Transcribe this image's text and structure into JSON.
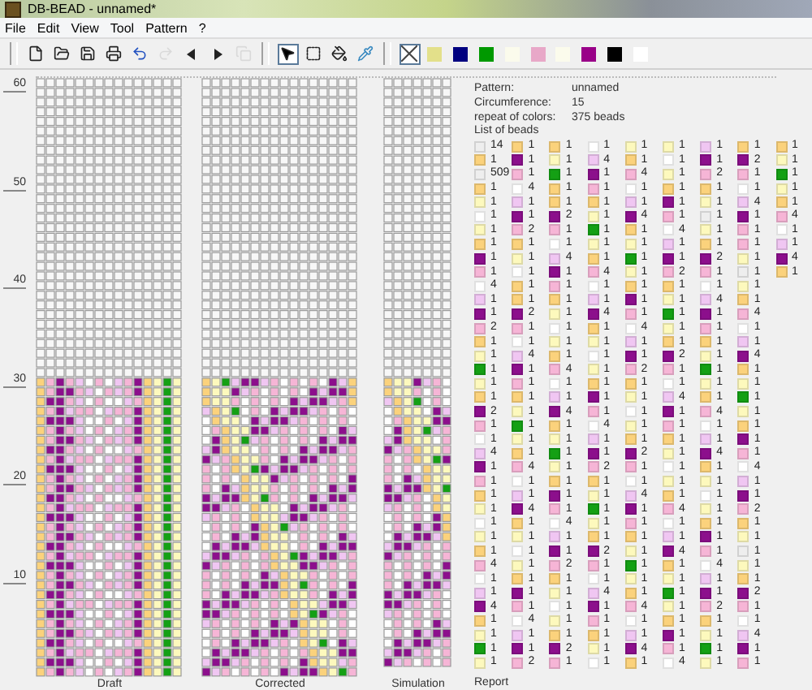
{
  "window": {
    "title": "DB-BEAD - unnamed*"
  },
  "menu": [
    "File",
    "Edit",
    "View",
    "Tool",
    "Pattern",
    "?"
  ],
  "tool_groups": [
    [
      {
        "kind": "new",
        "disabled": false,
        "selected": false
      },
      {
        "kind": "open",
        "disabled": false,
        "selected": false
      },
      {
        "kind": "save",
        "disabled": false,
        "selected": false
      },
      {
        "kind": "print",
        "disabled": false,
        "selected": false
      },
      {
        "kind": "undo",
        "disabled": false,
        "selected": false
      },
      {
        "kind": "redo",
        "disabled": true,
        "selected": false
      },
      {
        "kind": "left",
        "disabled": false,
        "selected": false
      },
      {
        "kind": "right",
        "disabled": false,
        "selected": false
      },
      {
        "kind": "copy",
        "disabled": true,
        "selected": false
      }
    ],
    [
      {
        "kind": "pointer",
        "disabled": false,
        "selected": true
      },
      {
        "kind": "rect",
        "disabled": false,
        "selected": false
      },
      {
        "kind": "fill",
        "disabled": false,
        "selected": false
      },
      {
        "kind": "pipette",
        "disabled": false,
        "selected": false
      }
    ],
    [
      {
        "kind": "none",
        "disabled": false,
        "selected": true
      }
    ]
  ],
  "palette": [
    {
      "color": "#e3e08a"
    },
    {
      "color": "#000080"
    },
    {
      "color": "#009900"
    },
    {
      "color": "#fbfbec"
    },
    {
      "color": "#e8a8c8"
    },
    {
      "color": "#fbfbec"
    },
    {
      "color": "#990088"
    },
    {
      "color": "#000000"
    },
    {
      "color": "#ffffff"
    }
  ],
  "ruler": [
    "60",
    "50",
    "40",
    "30",
    "20",
    "10"
  ],
  "views": [
    {
      "label": "Draft"
    },
    {
      "label": "Corrected"
    },
    {
      "label": "Simulation"
    }
  ],
  "info": [
    {
      "label": "Pattern:",
      "value": "unnamed"
    },
    {
      "label": "Circumference:",
      "value": "15"
    },
    {
      "label": "repeat of colors:",
      "value": "375 beads"
    }
  ],
  "list_title": "List of beads",
  "bead_rows": [
    [
      {
        "color": "#eeeeee",
        "count": "14"
      },
      {
        "color": "#fbd27c",
        "count": "1"
      },
      {
        "color": "#fbd27c",
        "count": "1"
      },
      {
        "color": "#ffffff",
        "count": "1"
      },
      {
        "color": "#fdf9bd",
        "count": "1"
      },
      {
        "color": "#fdf9bd",
        "count": "1"
      },
      {
        "color": "#f0c6f2",
        "count": "1"
      },
      {
        "color": "#fbd27c",
        "count": "1"
      },
      {
        "color": "#fbd27c",
        "count": "1"
      }
    ],
    [
      {
        "color": "#fbd27c",
        "count": "1"
      },
      {
        "color": "#8c0f8c",
        "count": "1"
      },
      {
        "color": "#fdf9bd",
        "count": "1"
      },
      {
        "color": "#f0c6f2",
        "count": "4"
      },
      {
        "color": "#fbd27c",
        "count": "1"
      },
      {
        "color": "#ffffff",
        "count": "1"
      },
      {
        "color": "#8c0f8c",
        "count": "1"
      },
      {
        "color": "#8c0f8c",
        "count": "2"
      },
      {
        "color": "#fdf9bd",
        "count": "1"
      }
    ],
    [
      {
        "color": "#eeeeee",
        "count": "509"
      },
      {
        "color": "#f6b5d6",
        "count": "1"
      },
      {
        "color": "#14a014",
        "count": "1"
      },
      {
        "color": "#8c0f8c",
        "count": "1"
      },
      {
        "color": "#f6b5d6",
        "count": "4"
      },
      {
        "color": "#fdf9bd",
        "count": "1"
      },
      {
        "color": "#f6b5d6",
        "count": "2"
      },
      {
        "color": "#f6b5d6",
        "count": "1"
      },
      {
        "color": "#14a014",
        "count": "1"
      }
    ],
    [
      {
        "color": "#fbd27c",
        "count": "1"
      },
      {
        "color": "#ffffff",
        "count": "4"
      },
      {
        "color": "#fbd27c",
        "count": "1"
      },
      {
        "color": "#f6b5d6",
        "count": "1"
      },
      {
        "color": "#ffffff",
        "count": "1"
      },
      {
        "color": "#fbd27c",
        "count": "1"
      },
      {
        "color": "#fbd27c",
        "count": "1"
      },
      {
        "color": "#ffffff",
        "count": "1"
      },
      {
        "color": "#fdf9bd",
        "count": "1"
      }
    ],
    [
      {
        "color": "#fdf9bd",
        "count": "1"
      },
      {
        "color": "#f0c6f2",
        "count": "1"
      },
      {
        "color": "#fbd27c",
        "count": "1"
      },
      {
        "color": "#fbd27c",
        "count": "1"
      },
      {
        "color": "#f0c6f2",
        "count": "1"
      },
      {
        "color": "#8c0f8c",
        "count": "1"
      },
      {
        "color": "#fdf9bd",
        "count": "1"
      },
      {
        "color": "#f0c6f2",
        "count": "4"
      },
      {
        "color": "#fbd27c",
        "count": "1"
      }
    ],
    [
      {
        "color": "#ffffff",
        "count": "1"
      },
      {
        "color": "#8c0f8c",
        "count": "1"
      },
      {
        "color": "#8c0f8c",
        "count": "2"
      },
      {
        "color": "#fdf9bd",
        "count": "1"
      },
      {
        "color": "#8c0f8c",
        "count": "4"
      },
      {
        "color": "#f6b5d6",
        "count": "1"
      },
      {
        "color": "#eeeeee",
        "count": "1"
      },
      {
        "color": "#8c0f8c",
        "count": "1"
      },
      {
        "color": "#f6b5d6",
        "count": "4"
      }
    ],
    [
      {
        "color": "#fdf9bd",
        "count": "1"
      },
      {
        "color": "#f6b5d6",
        "count": "2"
      },
      {
        "color": "#f6b5d6",
        "count": "1"
      },
      {
        "color": "#14a014",
        "count": "1"
      },
      {
        "color": "#fbd27c",
        "count": "1"
      },
      {
        "color": "#ffffff",
        "count": "4"
      },
      {
        "color": "#fdf9bd",
        "count": "1"
      },
      {
        "color": "#f6b5d6",
        "count": "1"
      },
      {
        "color": "#ffffff",
        "count": "1"
      }
    ],
    [
      {
        "color": "#fbd27c",
        "count": "1"
      },
      {
        "color": "#fbd27c",
        "count": "1"
      },
      {
        "color": "#ffffff",
        "count": "1"
      },
      {
        "color": "#fdf9bd",
        "count": "1"
      },
      {
        "color": "#fdf9bd",
        "count": "1"
      },
      {
        "color": "#f0c6f2",
        "count": "1"
      },
      {
        "color": "#fbd27c",
        "count": "1"
      },
      {
        "color": "#f6b5d6",
        "count": "1"
      },
      {
        "color": "#f0c6f2",
        "count": "1"
      }
    ],
    [
      {
        "color": "#8c0f8c",
        "count": "1"
      },
      {
        "color": "#fdf9bd",
        "count": "1"
      },
      {
        "color": "#f0c6f2",
        "count": "4"
      },
      {
        "color": "#fbd27c",
        "count": "1"
      },
      {
        "color": "#14a014",
        "count": "1"
      },
      {
        "color": "#8c0f8c",
        "count": "1"
      },
      {
        "color": "#8c0f8c",
        "count": "2"
      },
      {
        "color": "#fdf9bd",
        "count": "1"
      },
      {
        "color": "#8c0f8c",
        "count": "4"
      }
    ],
    [
      {
        "color": "#f6b5d6",
        "count": "1"
      },
      {
        "color": "#ffffff",
        "count": "1"
      },
      {
        "color": "#8c0f8c",
        "count": "1"
      },
      {
        "color": "#f6b5d6",
        "count": "4"
      },
      {
        "color": "#fdf9bd",
        "count": "1"
      },
      {
        "color": "#f6b5d6",
        "count": "2"
      },
      {
        "color": "#f6b5d6",
        "count": "1"
      },
      {
        "color": "#eeeeee",
        "count": "1"
      },
      {
        "color": "#fbd27c",
        "count": "1"
      }
    ],
    [
      {
        "color": "#ffffff",
        "count": "4"
      },
      {
        "color": "#fbd27c",
        "count": "1"
      },
      {
        "color": "#f6b5d6",
        "count": "1"
      },
      {
        "color": "#ffffff",
        "count": "1"
      },
      {
        "color": "#fbd27c",
        "count": "1"
      },
      {
        "color": "#fbd27c",
        "count": "1"
      },
      {
        "color": "#ffffff",
        "count": "1"
      },
      {
        "color": "#fdf9bd",
        "count": "1"
      }
    ],
    [
      {
        "color": "#f0c6f2",
        "count": "1"
      },
      {
        "color": "#fbd27c",
        "count": "1"
      },
      {
        "color": "#fbd27c",
        "count": "1"
      },
      {
        "color": "#f0c6f2",
        "count": "1"
      },
      {
        "color": "#8c0f8c",
        "count": "1"
      },
      {
        "color": "#fdf9bd",
        "count": "1"
      },
      {
        "color": "#f0c6f2",
        "count": "4"
      },
      {
        "color": "#fbd27c",
        "count": "1"
      }
    ],
    [
      {
        "color": "#8c0f8c",
        "count": "1"
      },
      {
        "color": "#8c0f8c",
        "count": "2"
      },
      {
        "color": "#fdf9bd",
        "count": "1"
      },
      {
        "color": "#8c0f8c",
        "count": "4"
      },
      {
        "color": "#f6b5d6",
        "count": "1"
      },
      {
        "color": "#14a014",
        "count": "1"
      },
      {
        "color": "#8c0f8c",
        "count": "1"
      },
      {
        "color": "#f6b5d6",
        "count": "4"
      }
    ],
    [
      {
        "color": "#f6b5d6",
        "count": "2"
      },
      {
        "color": "#f6b5d6",
        "count": "1"
      },
      {
        "color": "#ffffff",
        "count": "1"
      },
      {
        "color": "#fbd27c",
        "count": "1"
      },
      {
        "color": "#ffffff",
        "count": "4"
      },
      {
        "color": "#fdf9bd",
        "count": "1"
      },
      {
        "color": "#f6b5d6",
        "count": "1"
      },
      {
        "color": "#ffffff",
        "count": "1"
      }
    ],
    [
      {
        "color": "#fbd27c",
        "count": "1"
      },
      {
        "color": "#ffffff",
        "count": "1"
      },
      {
        "color": "#fdf9bd",
        "count": "1"
      },
      {
        "color": "#fdf9bd",
        "count": "1"
      },
      {
        "color": "#f0c6f2",
        "count": "1"
      },
      {
        "color": "#fbd27c",
        "count": "1"
      },
      {
        "color": "#fbd27c",
        "count": "1"
      },
      {
        "color": "#f0c6f2",
        "count": "1"
      }
    ],
    [
      {
        "color": "#fdf9bd",
        "count": "1"
      },
      {
        "color": "#f0c6f2",
        "count": "4"
      },
      {
        "color": "#fbd27c",
        "count": "1"
      },
      {
        "color": "#ffffff",
        "count": "1"
      },
      {
        "color": "#8c0f8c",
        "count": "1"
      },
      {
        "color": "#8c0f8c",
        "count": "2"
      },
      {
        "color": "#fdf9bd",
        "count": "1"
      },
      {
        "color": "#8c0f8c",
        "count": "4"
      }
    ],
    [
      {
        "color": "#14a014",
        "count": "1"
      },
      {
        "color": "#8c0f8c",
        "count": "1"
      },
      {
        "color": "#f6b5d6",
        "count": "4"
      },
      {
        "color": "#fdf9bd",
        "count": "1"
      },
      {
        "color": "#f6b5d6",
        "count": "2"
      },
      {
        "color": "#f6b5d6",
        "count": "1"
      },
      {
        "color": "#14a014",
        "count": "1"
      },
      {
        "color": "#fbd27c",
        "count": "1"
      }
    ],
    [
      {
        "color": "#fdf9bd",
        "count": "1"
      },
      {
        "color": "#f6b5d6",
        "count": "1"
      },
      {
        "color": "#ffffff",
        "count": "1"
      },
      {
        "color": "#fbd27c",
        "count": "1"
      },
      {
        "color": "#fbd27c",
        "count": "1"
      },
      {
        "color": "#ffffff",
        "count": "1"
      },
      {
        "color": "#fdf9bd",
        "count": "1"
      },
      {
        "color": "#fdf9bd",
        "count": "1"
      }
    ],
    [
      {
        "color": "#fbd27c",
        "count": "1"
      },
      {
        "color": "#fbd27c",
        "count": "1"
      },
      {
        "color": "#f0c6f2",
        "count": "1"
      },
      {
        "color": "#8c0f8c",
        "count": "1"
      },
      {
        "color": "#fdf9bd",
        "count": "1"
      },
      {
        "color": "#f0c6f2",
        "count": "4"
      },
      {
        "color": "#fbd27c",
        "count": "1"
      },
      {
        "color": "#14a014",
        "count": "1"
      }
    ],
    [
      {
        "color": "#8c0f8c",
        "count": "2"
      },
      {
        "color": "#fdf9bd",
        "count": "1"
      },
      {
        "color": "#8c0f8c",
        "count": "4"
      },
      {
        "color": "#f6b5d6",
        "count": "1"
      },
      {
        "color": "#ffffff",
        "count": "1"
      },
      {
        "color": "#8c0f8c",
        "count": "1"
      },
      {
        "color": "#f6b5d6",
        "count": "4"
      },
      {
        "color": "#fdf9bd",
        "count": "1"
      }
    ],
    [
      {
        "color": "#f6b5d6",
        "count": "1"
      },
      {
        "color": "#14a014",
        "count": "1"
      },
      {
        "color": "#fbd27c",
        "count": "1"
      },
      {
        "color": "#ffffff",
        "count": "4"
      },
      {
        "color": "#fdf9bd",
        "count": "1"
      },
      {
        "color": "#f6b5d6",
        "count": "1"
      },
      {
        "color": "#ffffff",
        "count": "1"
      },
      {
        "color": "#fbd27c",
        "count": "1"
      }
    ],
    [
      {
        "color": "#ffffff",
        "count": "1"
      },
      {
        "color": "#fdf9bd",
        "count": "1"
      },
      {
        "color": "#fdf9bd",
        "count": "1"
      },
      {
        "color": "#f0c6f2",
        "count": "1"
      },
      {
        "color": "#fbd27c",
        "count": "1"
      },
      {
        "color": "#fbd27c",
        "count": "1"
      },
      {
        "color": "#f0c6f2",
        "count": "1"
      },
      {
        "color": "#8c0f8c",
        "count": "1"
      }
    ],
    [
      {
        "color": "#f0c6f2",
        "count": "4"
      },
      {
        "color": "#fbd27c",
        "count": "1"
      },
      {
        "color": "#14a014",
        "count": "1"
      },
      {
        "color": "#8c0f8c",
        "count": "1"
      },
      {
        "color": "#8c0f8c",
        "count": "2"
      },
      {
        "color": "#fdf9bd",
        "count": "1"
      },
      {
        "color": "#8c0f8c",
        "count": "4"
      },
      {
        "color": "#f6b5d6",
        "count": "1"
      }
    ],
    [
      {
        "color": "#8c0f8c",
        "count": "1"
      },
      {
        "color": "#f6b5d6",
        "count": "4"
      },
      {
        "color": "#fdf9bd",
        "count": "1"
      },
      {
        "color": "#f6b5d6",
        "count": "2"
      },
      {
        "color": "#f6b5d6",
        "count": "1"
      },
      {
        "color": "#ffffff",
        "count": "1"
      },
      {
        "color": "#fbd27c",
        "count": "1"
      },
      {
        "color": "#ffffff",
        "count": "4"
      }
    ],
    [
      {
        "color": "#f6b5d6",
        "count": "1"
      },
      {
        "color": "#ffffff",
        "count": "1"
      },
      {
        "color": "#fbd27c",
        "count": "1"
      },
      {
        "color": "#fbd27c",
        "count": "1"
      },
      {
        "color": "#ffffff",
        "count": "1"
      },
      {
        "color": "#fdf9bd",
        "count": "1"
      },
      {
        "color": "#fdf9bd",
        "count": "1"
      },
      {
        "color": "#f0c6f2",
        "count": "1"
      }
    ],
    [
      {
        "color": "#fbd27c",
        "count": "1"
      },
      {
        "color": "#f0c6f2",
        "count": "1"
      },
      {
        "color": "#8c0f8c",
        "count": "1"
      },
      {
        "color": "#fdf9bd",
        "count": "1"
      },
      {
        "color": "#f0c6f2",
        "count": "4"
      },
      {
        "color": "#fbd27c",
        "count": "1"
      },
      {
        "color": "#ffffff",
        "count": "1"
      },
      {
        "color": "#8c0f8c",
        "count": "1"
      }
    ],
    [
      {
        "color": "#fdf9bd",
        "count": "1"
      },
      {
        "color": "#8c0f8c",
        "count": "4"
      },
      {
        "color": "#f6b5d6",
        "count": "1"
      },
      {
        "color": "#14a014",
        "count": "1"
      },
      {
        "color": "#8c0f8c",
        "count": "1"
      },
      {
        "color": "#f6b5d6",
        "count": "4"
      },
      {
        "color": "#fdf9bd",
        "count": "1"
      },
      {
        "color": "#f6b5d6",
        "count": "2"
      }
    ],
    [
      {
        "color": "#ffffff",
        "count": "1"
      },
      {
        "color": "#fbd27c",
        "count": "1"
      },
      {
        "color": "#ffffff",
        "count": "4"
      },
      {
        "color": "#fdf9bd",
        "count": "1"
      },
      {
        "color": "#f6b5d6",
        "count": "1"
      },
      {
        "color": "#ffffff",
        "count": "1"
      },
      {
        "color": "#fbd27c",
        "count": "1"
      },
      {
        "color": "#fbd27c",
        "count": "1"
      }
    ],
    [
      {
        "color": "#fdf9bd",
        "count": "1"
      },
      {
        "color": "#fdf9bd",
        "count": "1"
      },
      {
        "color": "#f0c6f2",
        "count": "1"
      },
      {
        "color": "#fbd27c",
        "count": "1"
      },
      {
        "color": "#fbd27c",
        "count": "1"
      },
      {
        "color": "#f0c6f2",
        "count": "1"
      },
      {
        "color": "#8c0f8c",
        "count": "1"
      },
      {
        "color": "#fdf9bd",
        "count": "1"
      }
    ],
    [
      {
        "color": "#fbd27c",
        "count": "1"
      },
      {
        "color": "#ffffff",
        "count": "1"
      },
      {
        "color": "#8c0f8c",
        "count": "1"
      },
      {
        "color": "#8c0f8c",
        "count": "2"
      },
      {
        "color": "#fdf9bd",
        "count": "1"
      },
      {
        "color": "#8c0f8c",
        "count": "4"
      },
      {
        "color": "#f6b5d6",
        "count": "1"
      },
      {
        "color": "#eeeeee",
        "count": "1"
      }
    ],
    [
      {
        "color": "#f6b5d6",
        "count": "4"
      },
      {
        "color": "#fdf9bd",
        "count": "1"
      },
      {
        "color": "#f6b5d6",
        "count": "2"
      },
      {
        "color": "#f6b5d6",
        "count": "1"
      },
      {
        "color": "#14a014",
        "count": "1"
      },
      {
        "color": "#fbd27c",
        "count": "1"
      },
      {
        "color": "#ffffff",
        "count": "4"
      },
      {
        "color": "#fdf9bd",
        "count": "1"
      }
    ],
    [
      {
        "color": "#ffffff",
        "count": "1"
      },
      {
        "color": "#fbd27c",
        "count": "1"
      },
      {
        "color": "#fbd27c",
        "count": "1"
      },
      {
        "color": "#ffffff",
        "count": "1"
      },
      {
        "color": "#fdf9bd",
        "count": "1"
      },
      {
        "color": "#fdf9bd",
        "count": "1"
      },
      {
        "color": "#f0c6f2",
        "count": "1"
      },
      {
        "color": "#fbd27c",
        "count": "1"
      }
    ],
    [
      {
        "color": "#f0c6f2",
        "count": "1"
      },
      {
        "color": "#8c0f8c",
        "count": "1"
      },
      {
        "color": "#fdf9bd",
        "count": "1"
      },
      {
        "color": "#f0c6f2",
        "count": "4"
      },
      {
        "color": "#fbd27c",
        "count": "1"
      },
      {
        "color": "#14a014",
        "count": "1"
      },
      {
        "color": "#8c0f8c",
        "count": "1"
      },
      {
        "color": "#8c0f8c",
        "count": "2"
      }
    ],
    [
      {
        "color": "#8c0f8c",
        "count": "4"
      },
      {
        "color": "#f6b5d6",
        "count": "1"
      },
      {
        "color": "#ffffff",
        "count": "1"
      },
      {
        "color": "#8c0f8c",
        "count": "1"
      },
      {
        "color": "#f6b5d6",
        "count": "4"
      },
      {
        "color": "#fdf9bd",
        "count": "1"
      },
      {
        "color": "#f6b5d6",
        "count": "2"
      },
      {
        "color": "#f6b5d6",
        "count": "1"
      }
    ],
    [
      {
        "color": "#fbd27c",
        "count": "1"
      },
      {
        "color": "#ffffff",
        "count": "4"
      },
      {
        "color": "#fdf9bd",
        "count": "1"
      },
      {
        "color": "#f6b5d6",
        "count": "1"
      },
      {
        "color": "#ffffff",
        "count": "1"
      },
      {
        "color": "#fbd27c",
        "count": "1"
      },
      {
        "color": "#fbd27c",
        "count": "1"
      },
      {
        "color": "#ffffff",
        "count": "1"
      }
    ],
    [
      {
        "color": "#fdf9bd",
        "count": "1"
      },
      {
        "color": "#f0c6f2",
        "count": "1"
      },
      {
        "color": "#fbd27c",
        "count": "1"
      },
      {
        "color": "#fbd27c",
        "count": "1"
      },
      {
        "color": "#f0c6f2",
        "count": "1"
      },
      {
        "color": "#8c0f8c",
        "count": "1"
      },
      {
        "color": "#fdf9bd",
        "count": "1"
      },
      {
        "color": "#f0c6f2",
        "count": "4"
      }
    ],
    [
      {
        "color": "#14a014",
        "count": "1"
      },
      {
        "color": "#8c0f8c",
        "count": "1"
      },
      {
        "color": "#8c0f8c",
        "count": "2"
      },
      {
        "color": "#fdf9bd",
        "count": "1"
      },
      {
        "color": "#8c0f8c",
        "count": "4"
      },
      {
        "color": "#f6b5d6",
        "count": "1"
      },
      {
        "color": "#14a014",
        "count": "1"
      },
      {
        "color": "#8c0f8c",
        "count": "1"
      }
    ],
    [
      {
        "color": "#fdf9bd",
        "count": "1"
      },
      {
        "color": "#f6b5d6",
        "count": "2"
      },
      {
        "color": "#f6b5d6",
        "count": "1"
      },
      {
        "color": "#ffffff",
        "count": "1"
      },
      {
        "color": "#fbd27c",
        "count": "1"
      },
      {
        "color": "#ffffff",
        "count": "4"
      },
      {
        "color": "#fdf9bd",
        "count": "1"
      },
      {
        "color": "#f6b5d6",
        "count": "1"
      }
    ]
  ],
  "report": "Report"
}
